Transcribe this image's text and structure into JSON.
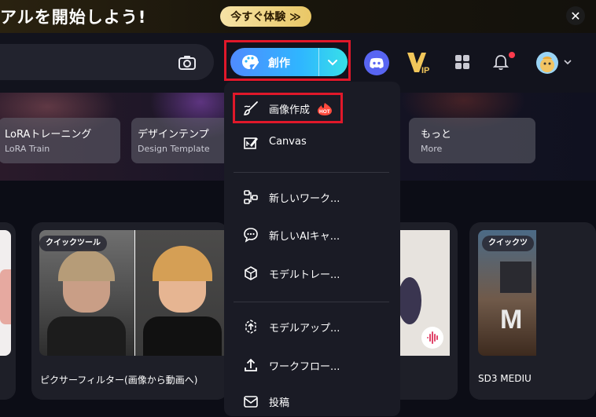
{
  "banner": {
    "promo_text": "アルを開始しよう!",
    "try_button": "今すぐ体験 ≫",
    "close_icon": "close-icon"
  },
  "header": {
    "search_icon": "camera-icon",
    "create_button": "創作",
    "create_icon": "palette-icon",
    "dropdown_icon": "chevron-down-icon",
    "discord_icon": "discord-icon",
    "vip_icon": "vip-icon",
    "apps_icon": "grid-icon",
    "notification_icon": "bell-icon",
    "accent": "#4f8bff"
  },
  "feature_cards": [
    {
      "title": "LoRAトレーニング",
      "subtitle": "LoRA Train"
    },
    {
      "title": "デザインテンプ",
      "subtitle": "Design Template"
    },
    {
      "title": "もっと",
      "subtitle": "More"
    }
  ],
  "tiles": [
    {
      "badge": "クイックツール",
      "label": "ピクサーフィルター(画像から動画へ)"
    },
    {
      "badge": "クイックツ",
      "label": "SD3 MEDIU"
    }
  ],
  "menu": {
    "items": [
      {
        "label": "画像作成",
        "icon": "brush-icon",
        "hot": "HOT"
      },
      {
        "label": "Canvas",
        "icon": "canvas-icon"
      },
      {
        "label": "新しいワーク...",
        "icon": "workflow-icon"
      },
      {
        "label": "新しいAIキャ...",
        "icon": "chat-icon"
      },
      {
        "label": "モデルトレー...",
        "icon": "cube-icon"
      },
      {
        "label": "モデルアップ...",
        "icon": "upload-model-icon"
      },
      {
        "label": "ワークフロー...",
        "icon": "upload-icon"
      },
      {
        "label": "投稿",
        "icon": "post-icon"
      }
    ]
  }
}
